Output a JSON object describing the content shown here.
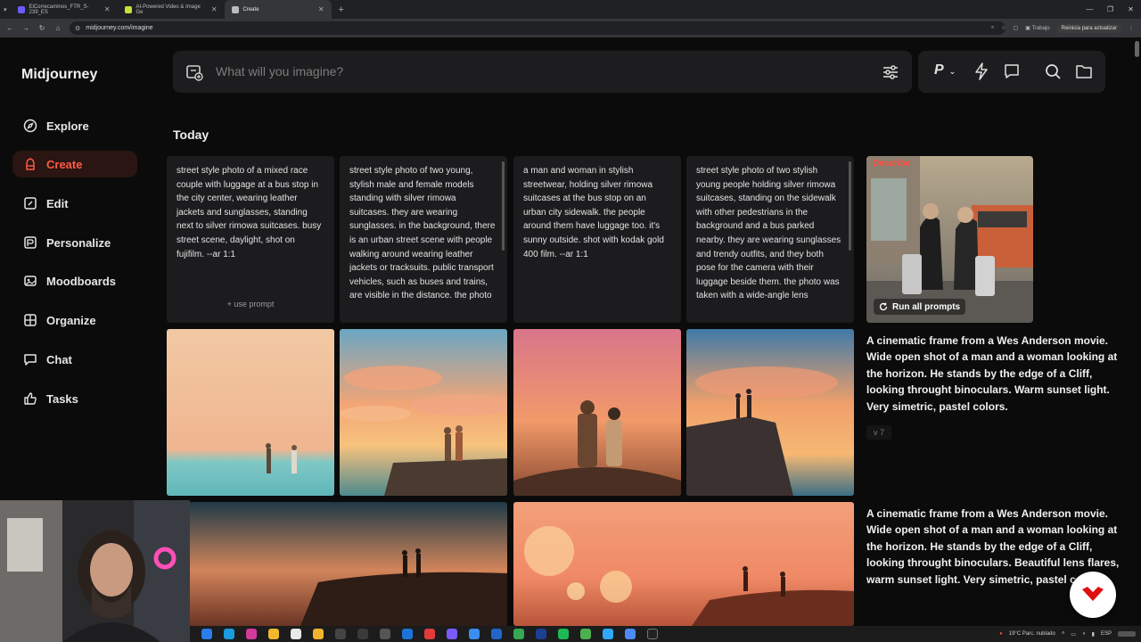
{
  "browser": {
    "tabs": [
      {
        "title": "ElCorrecaminos_FTR_S-239_ES",
        "color": "#6b5cff"
      },
      {
        "title": "AI-Powered Video & Image Ge",
        "color": "#c8e03a"
      },
      {
        "title": "Create",
        "color": "#bbbbbb"
      }
    ],
    "url": "midjourney.com/imagine",
    "profile": "Trabajo",
    "restart_label": "Reinicia para actualizar"
  },
  "sidebar": {
    "brand": "Midjourney",
    "items": [
      {
        "label": "Explore",
        "icon": "compass-icon"
      },
      {
        "label": "Create",
        "icon": "brush-icon",
        "active": true
      },
      {
        "label": "Edit",
        "icon": "edit-icon"
      },
      {
        "label": "Personalize",
        "icon": "personalize-icon"
      },
      {
        "label": "Moodboards",
        "icon": "moodboard-icon"
      },
      {
        "label": "Organize",
        "icon": "grid-icon"
      },
      {
        "label": "Chat",
        "icon": "chat-icon"
      },
      {
        "label": "Tasks",
        "icon": "thumbs-up-icon"
      }
    ]
  },
  "search": {
    "placeholder": "What will you imagine?"
  },
  "toolbar": {
    "personalize_letter": "P"
  },
  "section": {
    "title": "Today"
  },
  "prompts": [
    {
      "text": "street style photo of a mixed race couple with luggage at a bus stop in the city center, wearing leather jackets and sunglasses, standing next to silver rimowa suitcases. busy street scene, daylight, shot on fujifilm. --ar 1:1",
      "use": "+ use prompt"
    },
    {
      "text": "street style photo of two young, stylish male and female models standing with silver rimowa suitcases. they are wearing sunglasses. in the background, there is an urban street scene with people walking around wearing leather jackets or tracksuits. public transport vehicles, such as buses and trains, are visible in the distance. the photo"
    },
    {
      "text": "a man and woman in stylish streetwear, holding silver rimowa suitcases at the bus stop on an urban city sidewalk. the people around them have luggage too. it's sunny outside. shot with kodak gold 400 film. --ar 1:1"
    },
    {
      "text": "street style photo of two stylish young people holding silver rimowa suitcases, standing on the sidewalk with other pedestrians in the background and a bus parked nearby. they are wearing sunglasses and trendy outfits, and they both pose for the camera with their luggage beside them. the photo was taken with a wide-angle lens"
    }
  ],
  "describe": {
    "label": "Describe",
    "run_label": "Run all prompts"
  },
  "generations": [
    {
      "prompt": "A cinematic frame from a Wes Anderson movie. Wide open shot of a man and a woman looking at the horizon. He stands by the edge of a Cliff, looking throught binoculars. Warm sunset light. Very simetric, pastel colors.",
      "version": "v 7"
    },
    {
      "prompt": "A cinematic frame from a Wes Anderson movie. Wide open shot of a man and a woman looking at the horizon. He stands by the edge of a Cliff, looking throught binoculars. Beautiful lens flares, warm sunset light. Very simetric, pastel colors."
    }
  ],
  "taskbar": {
    "weather": "19°C  Parc. nublado",
    "lang": "ESP"
  }
}
